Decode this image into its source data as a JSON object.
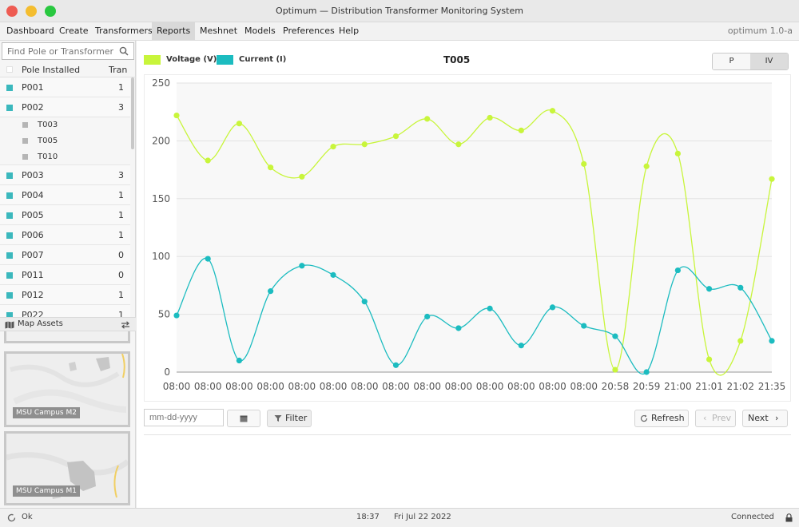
{
  "window": {
    "title": "Optimum — Distribution Transformer Monitoring System"
  },
  "menu": {
    "items": [
      "Dashboard",
      "Create",
      "Transformers",
      "Reports",
      "Meshnet",
      "Models",
      "Preferences",
      "Help"
    ],
    "active": "Reports",
    "version": "optimum 1.0-a"
  },
  "sidebar": {
    "search_placeholder": "Find Pole or Transformer",
    "header_pole": "Pole Installed",
    "header_tran": "Tran",
    "poles": [
      {
        "label": "P001",
        "count": "1"
      },
      {
        "label": "P002",
        "count": "3",
        "children": [
          "T003",
          "T005",
          "T010"
        ]
      },
      {
        "label": "P003",
        "count": "3"
      },
      {
        "label": "P004",
        "count": "1"
      },
      {
        "label": "P005",
        "count": "1"
      },
      {
        "label": "P006",
        "count": "1"
      },
      {
        "label": "P007",
        "count": "0"
      },
      {
        "label": "P011",
        "count": "0"
      },
      {
        "label": "P012",
        "count": "1"
      },
      {
        "label": "P022",
        "count": "1"
      }
    ],
    "assets_label": "Map Assets",
    "thumbnails": [
      "MSU Campus M2",
      "MSU Campus M1"
    ]
  },
  "chart_controls": {
    "segments": [
      "P",
      "IV"
    ],
    "active_segment": "IV"
  },
  "chart_data": {
    "type": "line",
    "title": "T005",
    "categories": [
      "08:00",
      "08:00",
      "08:00",
      "08:00",
      "08:00",
      "08:00",
      "08:00",
      "08:00",
      "08:00",
      "08:00",
      "08:00",
      "08:00",
      "08:00",
      "08:00",
      "20:58",
      "20:59",
      "21:00",
      "21:01",
      "21:02",
      "21:35"
    ],
    "ylim": [
      0,
      250
    ],
    "yticks": [
      0,
      50,
      100,
      150,
      200,
      250
    ],
    "grid": true,
    "legend_position": "top-left",
    "series": [
      {
        "name": "Voltage (V)",
        "color": "#c8f53b",
        "values": [
          222,
          183,
          215,
          177,
          169,
          195,
          197,
          204,
          219,
          197,
          220,
          209,
          226,
          180,
          2,
          178,
          189,
          11,
          27,
          167
        ]
      },
      {
        "name": "Current (I)",
        "color": "#1cbcc0",
        "values": [
          49,
          98,
          10,
          70,
          92,
          84,
          61,
          6,
          48,
          38,
          55,
          23,
          56,
          40,
          31,
          0,
          88,
          72,
          73,
          27
        ]
      }
    ]
  },
  "controls": {
    "date_placeholder": "mm-dd-yyyy",
    "filter_label": "Filter",
    "refresh_label": "Refresh",
    "prev_label": "Prev",
    "next_label": "Next"
  },
  "status": {
    "state": "Ok",
    "time": "18:37",
    "date": "Fri Jul 22 2022",
    "connection": "Connected"
  }
}
